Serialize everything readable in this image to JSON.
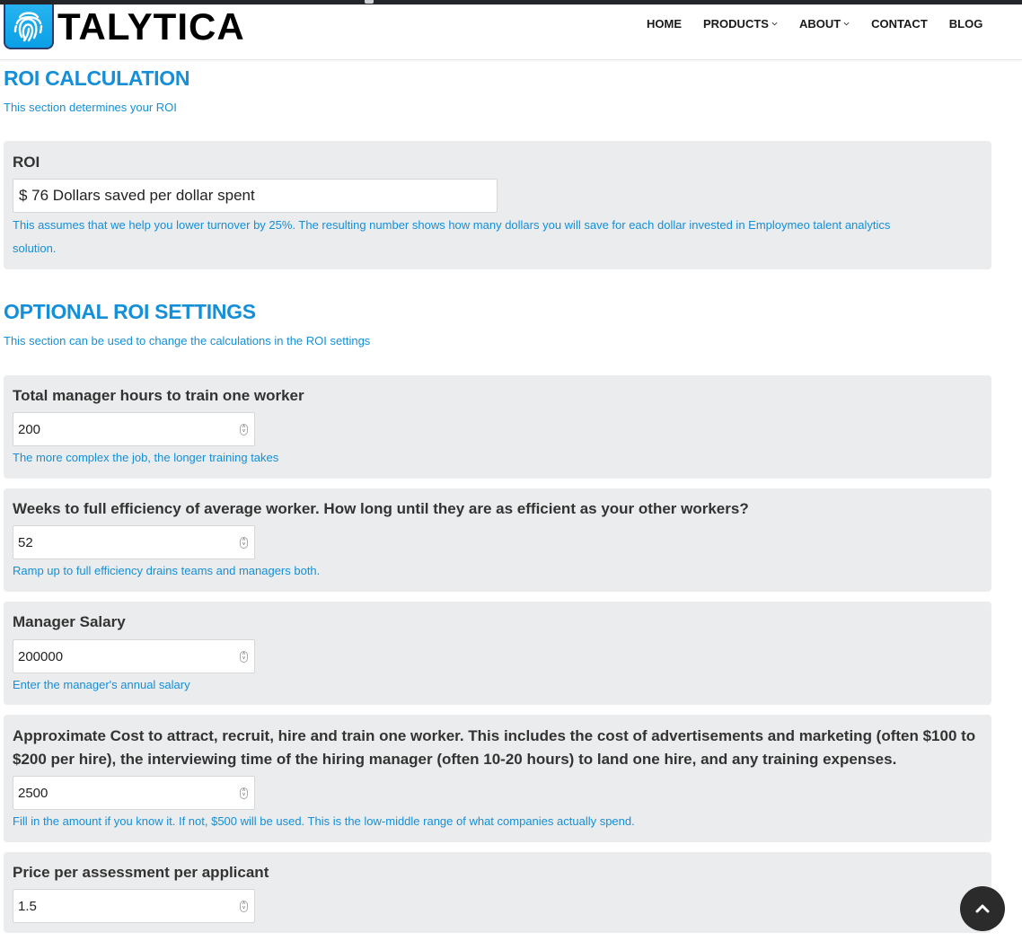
{
  "brand": {
    "name": "TALYTICA",
    "logo_icon": "fingerprint-icon",
    "logo_color": "#0aa0e6"
  },
  "nav": {
    "items": [
      {
        "label": "HOME",
        "has_dropdown": false
      },
      {
        "label": "PRODUCTS",
        "has_dropdown": true
      },
      {
        "label": "ABOUT",
        "has_dropdown": true
      },
      {
        "label": "CONTACT",
        "has_dropdown": false
      },
      {
        "label": "BLOG",
        "has_dropdown": false
      }
    ]
  },
  "roi_section": {
    "title": "ROI CALCULATION",
    "subtitle": "This section determines your ROI",
    "roi": {
      "label": "ROI",
      "value": "$ 76 Dollars saved per dollar spent",
      "help_line1": "This assumes that we help you lower turnover by 25%. The resulting number shows how many dollars you will save for each dollar invested in Employmeo talent analytics",
      "help_line2": "solution."
    }
  },
  "optional_section": {
    "title": "OPTIONAL ROI SETTINGS",
    "subtitle": "This section can be used to change the calculations in the ROI settings",
    "fields": [
      {
        "label": "Total manager hours to train one worker",
        "value": "200",
        "help": "The more complex the job, the longer training takes"
      },
      {
        "label": "Weeks to full efficiency of average worker. How long until they are as efficient as your other workers?",
        "value": "52",
        "help": "Ramp up to full efficiency drains teams and managers both."
      },
      {
        "label": "Manager Salary",
        "value": "200000",
        "help": "Enter the manager's annual salary"
      },
      {
        "label_line1": "Approximate Cost to attract, recruit, hire and train one worker. This includes the cost of advertisements and marketing (often $100 to",
        "label_line2": "$200 per hire), the interviewing time of the hiring manager (often 10-20 hours) to land one hire, and any training expenses.",
        "value": "2500",
        "help": "Fill in the amount if you know it. If not, $500 will be used. This is the low-middle range of what companies actually spend."
      },
      {
        "label": "Price per assessment per applicant",
        "value": "1.5"
      }
    ]
  },
  "back_to_top": {
    "icon": "chevron-up-icon"
  },
  "colors": {
    "accent": "#148fd8",
    "panel_bg": "#ebeced",
    "header_bar": "#23272b"
  }
}
